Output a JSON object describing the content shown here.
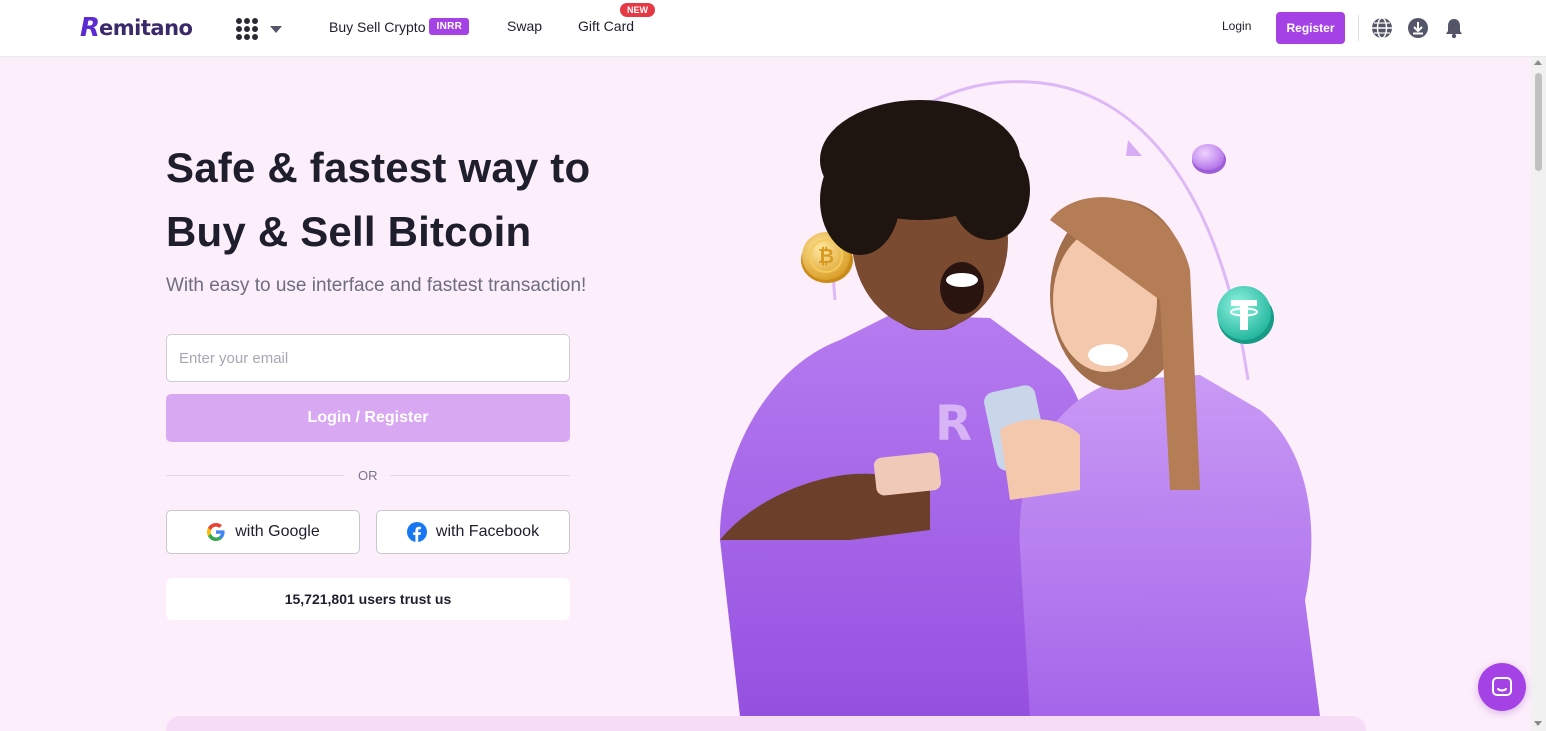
{
  "header": {
    "logo_mark": "R",
    "logo_text": "emitano",
    "nav": {
      "buy_sell_label": "Buy Sell Crypto",
      "buy_sell_badge": "INRR",
      "swap_label": "Swap",
      "gift_card_label": "Gift Card",
      "gift_card_badge": "NEW"
    },
    "login_label": "Login",
    "register_label": "Register",
    "icons": [
      "apps-grid-icon",
      "chevron-down-icon",
      "globe-icon",
      "download-icon",
      "bell-icon"
    ]
  },
  "hero": {
    "title_line1": "Safe & fastest way to",
    "title_line2": "Buy & Sell Bitcoin",
    "subtitle": "With easy to use interface and fastest transaction!",
    "email_placeholder": "Enter your email",
    "main_button_label": "Login / Register",
    "or_text": "OR",
    "google_label": "with Google",
    "facebook_label": "with Facebook",
    "trust_text": "15,721,801 users trust us"
  },
  "illustration": {
    "shirt_logo": "R",
    "coins": [
      "bitcoin-coin-icon",
      "tether-coin-icon",
      "tether-coin-icon",
      "purple-coin-icon"
    ]
  },
  "colors": {
    "brand_purple": "#a542e6",
    "background_pink": "#fdeefb",
    "button_disabled": "#d8a8f2",
    "new_badge_red": "#e63946"
  }
}
